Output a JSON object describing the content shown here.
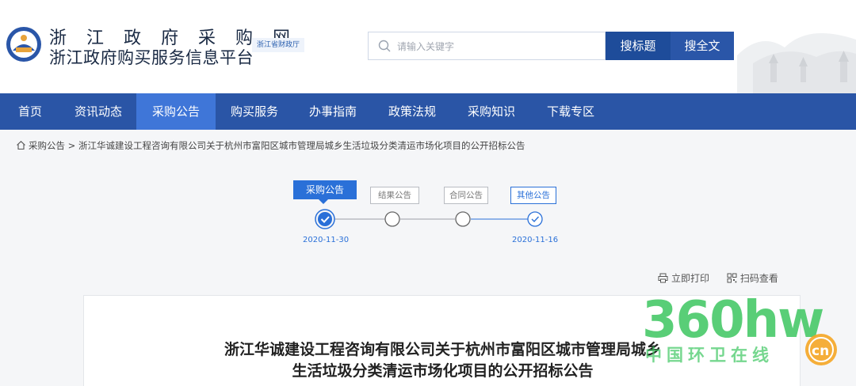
{
  "header": {
    "title_line1": "浙 江 政 府 采 购 网",
    "title_line2": "浙江政府购买服务信息平台",
    "dept_tag": "浙江省财政厅"
  },
  "search": {
    "placeholder": "请输入关键字",
    "value": "",
    "btn_title": "搜标题",
    "btn_fulltext": "搜全文"
  },
  "nav": {
    "items": [
      "首页",
      "资讯动态",
      "采购公告",
      "购买服务",
      "办事指南",
      "政策法规",
      "采购知识",
      "下载专区"
    ],
    "active_index": 2
  },
  "breadcrumb": {
    "root": "采购公告",
    "separator": ">",
    "current": "浙江华诚建设工程咨询有限公司关于杭州市富阳区城市管理局城乡生活垃圾分类清运市场化项目的公开招标公告"
  },
  "steps": {
    "tabs": [
      "采购公告",
      "结果公告",
      "合同公告",
      "其他公告"
    ],
    "dates": [
      "2020-11-30",
      "2020-11-16"
    ]
  },
  "tools": {
    "print": "立即打印",
    "qr": "扫码查看"
  },
  "notice": {
    "title_line1": "浙江华诚建设工程咨询有限公司关于杭州市富阳区城市管理局城乡",
    "title_line2": "生活垃圾分类清运市场化项目的公开招标公告"
  },
  "watermark": {
    "brand": "360hw",
    "tagline": "中国环卫在线",
    "badge": "cn"
  },
  "colors": {
    "nav_bg": "#2a55a6",
    "nav_active": "#3f76d8",
    "accent": "#2a70d8",
    "watermark_green": "#3cc65f",
    "watermark_orange": "#f5a623"
  }
}
